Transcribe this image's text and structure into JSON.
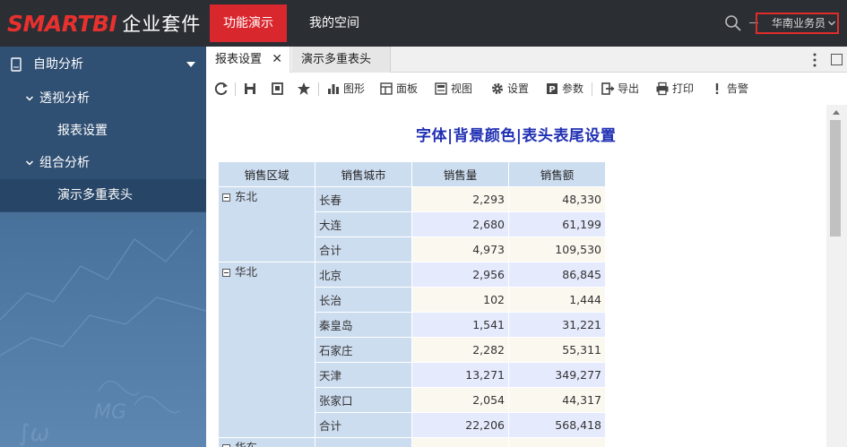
{
  "header": {
    "logo_brand": "SMARTBI",
    "logo_sub": "企业套件",
    "nav": [
      {
        "label": "功能演示",
        "active": true
      },
      {
        "label": "我的空间",
        "active": false
      }
    ],
    "user": "华南业务员",
    "accent_color": "#d9272e"
  },
  "sidebar": {
    "items": [
      {
        "label": "自助分析"
      },
      {
        "label": "透视分析"
      },
      {
        "label": "报表设置"
      },
      {
        "label": "组合分析"
      },
      {
        "label": "演示多重表头",
        "selected": true
      }
    ]
  },
  "tabs": [
    {
      "label": "报表设置",
      "active": true
    },
    {
      "label": "演示多重表头",
      "active": false
    }
  ],
  "toolbar": {
    "chart": "图形",
    "panel": "面板",
    "view": "视图",
    "settings": "设置",
    "params": "参数",
    "export": "导出",
    "print": "打印",
    "alert": "告警"
  },
  "report": {
    "title": "字体|背景颜色|表头表尾设置",
    "headers": [
      "销售区域",
      "销售城市",
      "销售量",
      "销售额"
    ],
    "groups": [
      {
        "region": "东北",
        "rows": [
          {
            "city": "长春",
            "qty": "2,293",
            "amount": "48,330"
          },
          {
            "city": "大连",
            "qty": "2,680",
            "amount": "61,199"
          },
          {
            "city": "合计",
            "qty": "4,973",
            "amount": "109,530"
          }
        ]
      },
      {
        "region": "华北",
        "rows": [
          {
            "city": "北京",
            "qty": "2,956",
            "amount": "86,845"
          },
          {
            "city": "长治",
            "qty": "102",
            "amount": "1,444"
          },
          {
            "city": "秦皇岛",
            "qty": "1,541",
            "amount": "31,221"
          },
          {
            "city": "石家庄",
            "qty": "2,282",
            "amount": "55,311"
          },
          {
            "city": "天津",
            "qty": "13,271",
            "amount": "349,277"
          },
          {
            "city": "张家口",
            "qty": "2,054",
            "amount": "44,317"
          },
          {
            "city": "合计",
            "qty": "22,206",
            "amount": "568,418"
          }
        ]
      },
      {
        "region": "华东",
        "rows": [
          {
            "city": "",
            "qty": "",
            "amount": ""
          }
        ]
      }
    ]
  }
}
